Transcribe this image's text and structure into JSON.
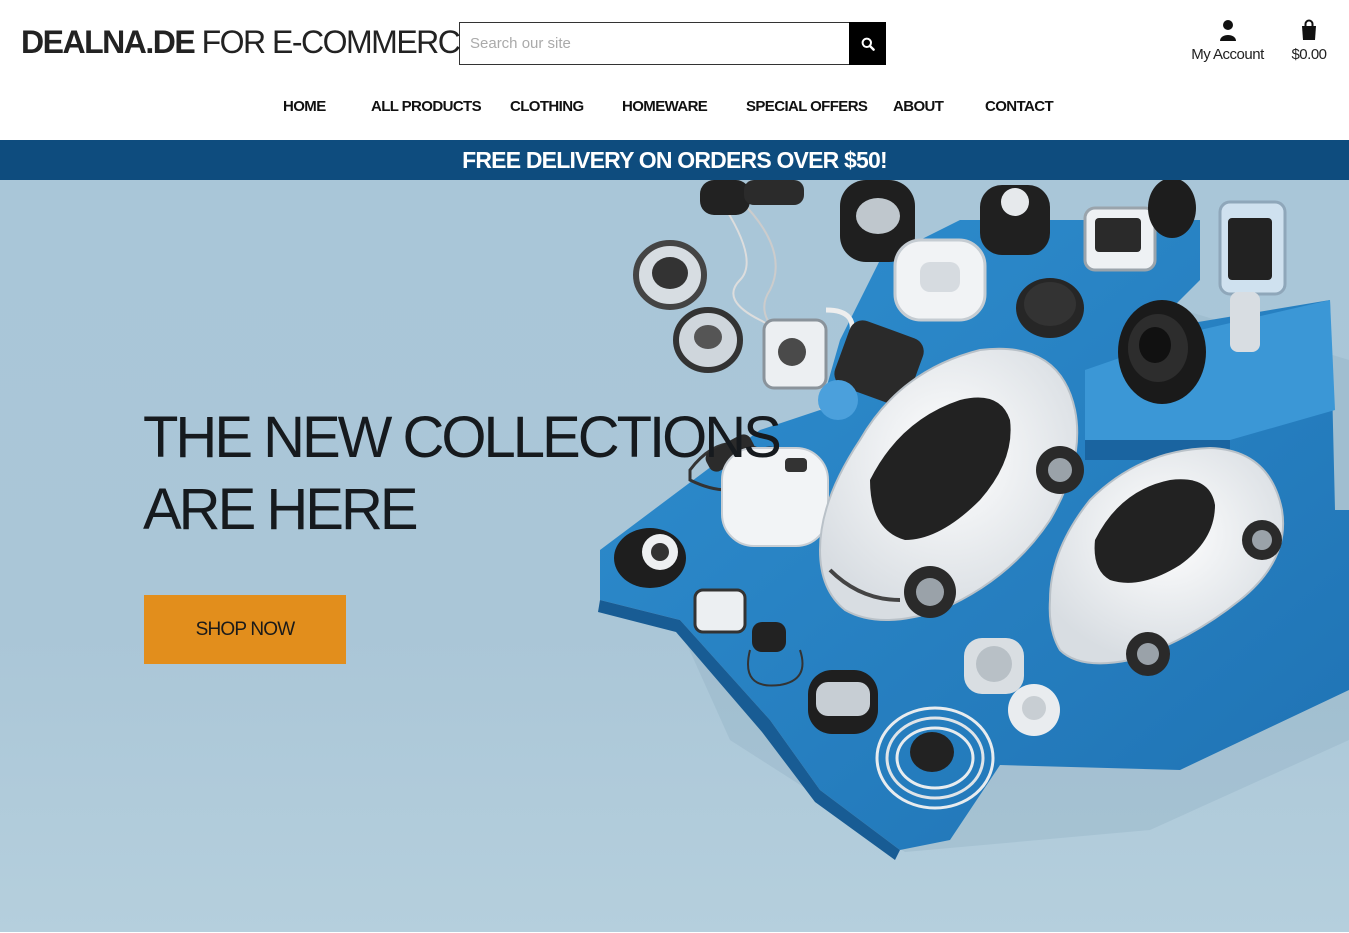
{
  "header": {
    "logo_bold": "DEALNA.DE",
    "logo_light": " FOR E-COMMERCE",
    "search_placeholder": "Search our site",
    "account_label": "My Account",
    "cart_total": "$0.00"
  },
  "nav": {
    "items": [
      {
        "label": "HOME"
      },
      {
        "label": "ALL PRODUCTS"
      },
      {
        "label": "CLOTHING"
      },
      {
        "label": "HOMEWARE"
      },
      {
        "label": "SPECIAL OFFERS"
      },
      {
        "label": "ABOUT"
      },
      {
        "label": "CONTACT"
      }
    ]
  },
  "promo": {
    "text": "FREE DELIVERY ON ORDERS OVER $50!"
  },
  "hero": {
    "title_line1": "THE NEW COLLECTIONS",
    "title_line2": "ARE HERE",
    "cta_label": "SHOP NOW"
  },
  "colors": {
    "promo_bar": "#0e4c7e",
    "cta": "#e28e1c",
    "hero_bg": "#a9c6d8",
    "platform_blue": "#2b86c6"
  },
  "icons": {
    "search": "search-icon",
    "account": "user-icon",
    "cart": "shopping-bag-icon"
  }
}
